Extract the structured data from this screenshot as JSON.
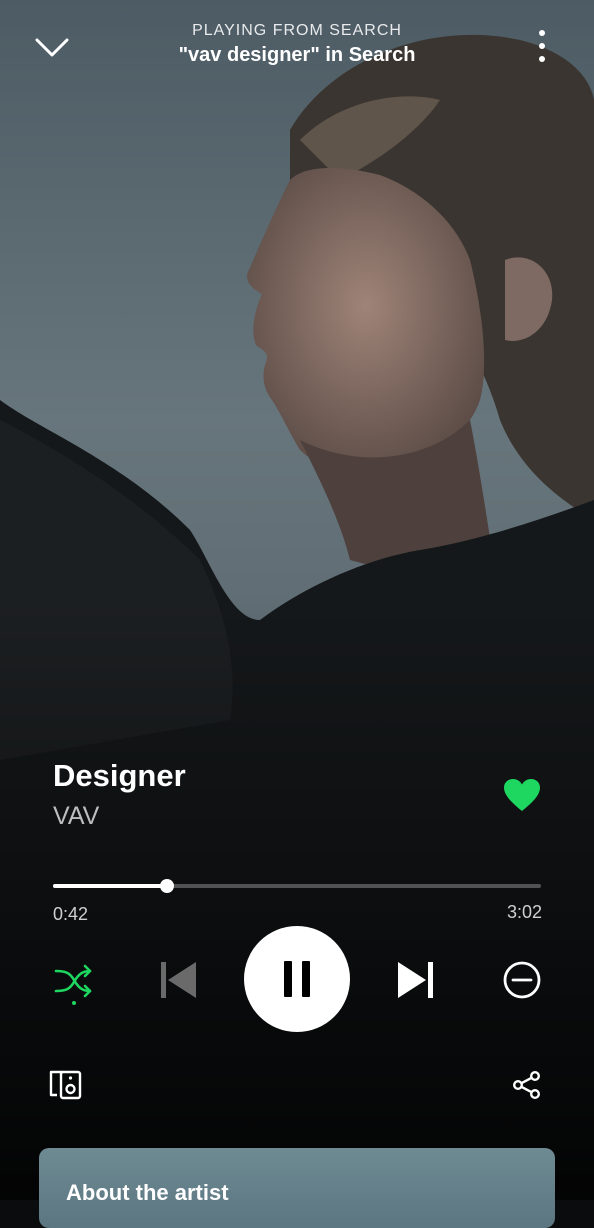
{
  "header": {
    "context_label": "PLAYING FROM SEARCH",
    "context_name": "\"vav designer\" in Search",
    "collapse_icon": "chevron-down-icon",
    "more_icon": "more-vertical-icon"
  },
  "track": {
    "title": "Designer",
    "artist": "VAV",
    "liked": true
  },
  "playback": {
    "elapsed": "0:42",
    "duration": "3:02",
    "progress": 0.234,
    "is_playing": true,
    "shuffle": true
  },
  "controls": {
    "shuffle_icon": "shuffle-icon",
    "previous_icon": "skip-previous-icon",
    "play_pause_icon": "pause-icon",
    "next_icon": "skip-next-icon",
    "hide_icon": "minus-circle-icon",
    "devices_icon": "connect-devices-icon",
    "share_icon": "share-icon"
  },
  "about": {
    "title": "About the artist"
  },
  "colors": {
    "accent": "#1ed760",
    "background": "#0b0c0d",
    "text_secondary": "#bdbdbd",
    "card": "#6e8a93"
  }
}
